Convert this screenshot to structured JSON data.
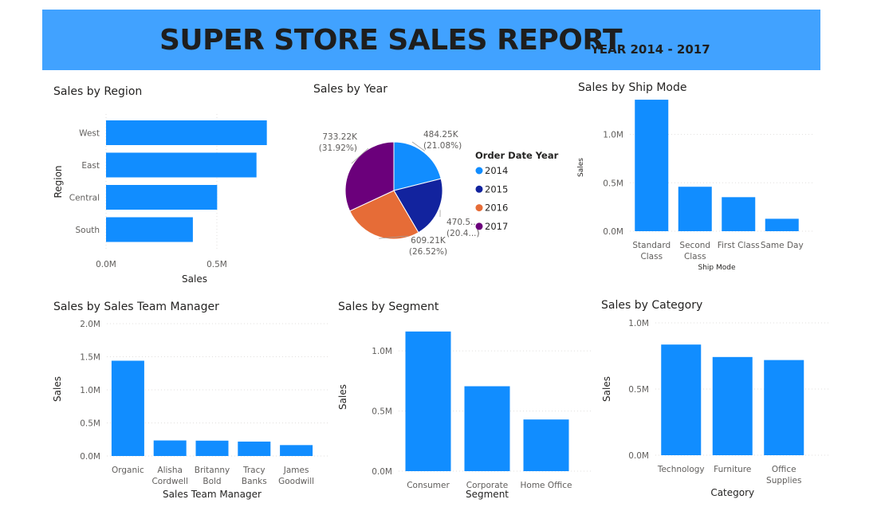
{
  "header": {
    "title": "SUPER STORE SALES REPORT",
    "subtitle": "YEAR 2014 - 2017"
  },
  "colors": {
    "bar": "#118dff",
    "banner": "#41a2ff",
    "pie_2014": "#118dff",
    "pie_2015": "#12239e",
    "pie_2016": "#e66c37",
    "pie_2017": "#6b007b"
  },
  "chart_data": [
    {
      "id": "region",
      "type": "bar",
      "orientation": "horizontal",
      "title": "Sales by Region",
      "categories": [
        "West",
        "East",
        "Central",
        "South"
      ],
      "values": [
        725458,
        678781,
        501240,
        391722
      ],
      "xlabel": "Sales",
      "ylabel": "Region",
      "xlim": [
        0,
        1000000
      ],
      "xticks": [
        "0.0M",
        "0.5M"
      ],
      "grid": true
    },
    {
      "id": "year",
      "type": "pie",
      "title": "Sales by Year",
      "legend_title": "Order Date Year",
      "legend_position": "right",
      "slices": [
        {
          "label": "2014",
          "value": 484.25,
          "data_label": "484.25K",
          "percent_label": "(21.08%)"
        },
        {
          "label": "2015",
          "value": 470.53,
          "data_label": "470.5...",
          "percent_label": "(20.4...)"
        },
        {
          "label": "2016",
          "value": 609.21,
          "data_label": "609.21K",
          "percent_label": "(26.52%)"
        },
        {
          "label": "2017",
          "value": 733.22,
          "data_label": "733.22K",
          "percent_label": "(31.92%)"
        }
      ]
    },
    {
      "id": "shipmode",
      "type": "bar",
      "title": "Sales by Ship Mode",
      "categories": [
        [
          "Standard",
          "Class"
        ],
        [
          "Second",
          "Class"
        ],
        [
          "First Class"
        ],
        [
          "Same Day"
        ]
      ],
      "values": [
        1358216,
        459194,
        351428,
        128363
      ],
      "xlabel": "Ship Mode",
      "ylabel": "Sales",
      "ylim": [
        0,
        1400000
      ],
      "yticks": [
        {
          "v": 0,
          "t": "0.0M"
        },
        {
          "v": 500000,
          "t": "0.5M"
        },
        {
          "v": 1000000,
          "t": "1.0M"
        }
      ],
      "grid": true
    },
    {
      "id": "manager",
      "type": "bar",
      "title": "Sales by Sales Team Manager",
      "categories": [
        [
          "Organic"
        ],
        [
          "Alisha",
          "Cordwell"
        ],
        [
          "Britanny",
          "Bold"
        ],
        [
          "Tracy",
          "Banks"
        ],
        [
          "James",
          "Goodwill"
        ]
      ],
      "values": [
        1440000,
        235000,
        232000,
        218000,
        165000
      ],
      "xlabel": "Sales Team Manager",
      "ylabel": "Sales",
      "ylim": [
        0,
        2000000
      ],
      "yticks": [
        {
          "v": 0,
          "t": "0.0M"
        },
        {
          "v": 500000,
          "t": "0.5M"
        },
        {
          "v": 1000000,
          "t": "1.0M"
        },
        {
          "v": 1500000,
          "t": "1.5M"
        },
        {
          "v": 2000000,
          "t": "2.0M"
        }
      ],
      "grid": true
    },
    {
      "id": "segment",
      "type": "bar",
      "title": "Sales by Segment",
      "categories": [
        [
          "Consumer"
        ],
        [
          "Corporate"
        ],
        [
          "Home Office"
        ]
      ],
      "values": [
        1161401,
        706146,
        429653
      ],
      "xlabel": "Segment",
      "ylabel": "Sales",
      "ylim": [
        0,
        1200000
      ],
      "yticks": [
        {
          "v": 0,
          "t": "0.0M"
        },
        {
          "v": 500000,
          "t": "0.5M"
        },
        {
          "v": 1000000,
          "t": "1.0M"
        }
      ],
      "grid": true
    },
    {
      "id": "category",
      "type": "bar",
      "title": "Sales by Category",
      "categories": [
        [
          "Technology"
        ],
        [
          "Furniture"
        ],
        [
          "Office",
          "Supplies"
        ]
      ],
      "values": [
        836154,
        741999,
        719047
      ],
      "xlabel": "Category",
      "ylabel": "Sales",
      "ylim": [
        0,
        1000000
      ],
      "yticks": [
        {
          "v": 0,
          "t": "0.0M"
        },
        {
          "v": 500000,
          "t": "0.5M"
        },
        {
          "v": 1000000,
          "t": "1.0M"
        }
      ],
      "grid": true
    }
  ]
}
